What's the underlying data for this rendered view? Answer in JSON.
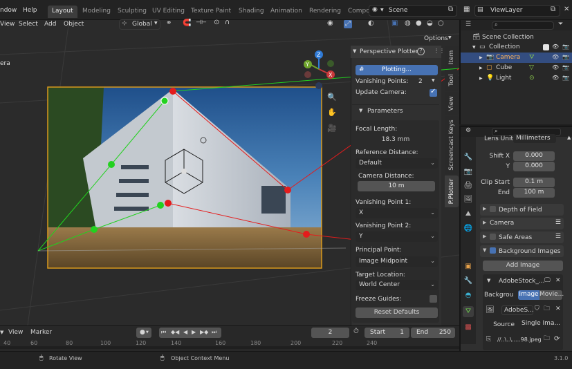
{
  "topbar": {
    "menus": [
      "ndow",
      "Help"
    ],
    "workspaces": [
      "Layout",
      "Modeling",
      "Sculpting",
      "UV Editing",
      "Texture Paint",
      "Shading",
      "Animation",
      "Rendering",
      "Compo"
    ],
    "active_workspace": "Layout",
    "scene_name": "Scene",
    "view_layer_name": "ViewLayer"
  },
  "viewport_header": {
    "menus": [
      "View",
      "Select",
      "Add",
      "Object"
    ],
    "orientation": "Global",
    "options_label": "Options"
  },
  "viewport": {
    "corner_text_1": "",
    "corner_text_2": "era"
  },
  "npanel": {
    "title": "Perspective Plotter",
    "plotting_button": "Plotting...",
    "vanishing_points_label": "Vanishing Points:",
    "vanishing_points_value": "2",
    "update_camera_label": "Update Camera:",
    "update_camera_checked": true,
    "parameters_label": "Parameters",
    "focal_length_label": "Focal Length:",
    "focal_length_value": "18.3 mm",
    "reference_distance_label": "Reference Distance:",
    "reference_distance_value": "Default",
    "camera_distance_label": "Camera Distance:",
    "camera_distance_value": "10 m",
    "vp1_label": "Vanishing Point 1:",
    "vp1_value": "X",
    "vp2_label": "Vanishing Point 2:",
    "vp2_value": "Y",
    "principal_point_label": "Principal Point:",
    "principal_point_value": "Image Midpoint",
    "target_location_label": "Target Location:",
    "target_location_value": "World Center",
    "freeze_guides_label": "Freeze Guides:",
    "freeze_guides_checked": false,
    "reset_button": "Reset Defaults"
  },
  "npanel_tabs": [
    "Item",
    "Tool",
    "View",
    "Screencast Keys",
    "P.Plotter"
  ],
  "active_npanel_tab": "P.Plotter",
  "outliner": {
    "items": [
      {
        "label": "Scene Collection",
        "indent": 0
      },
      {
        "label": "Collection",
        "indent": 1
      },
      {
        "label": "Camera",
        "indent": 2,
        "selected": true
      },
      {
        "label": "Cube",
        "indent": 2
      },
      {
        "label": "Light",
        "indent": 2
      }
    ]
  },
  "properties": {
    "lens_unit_label": "Lens Unit",
    "lens_unit_value": "Millimeters",
    "shift_x_label": "Shift X",
    "shift_x_value": "0.000",
    "shift_y_label": "Y",
    "shift_y_value": "0.000",
    "clip_start_label": "Clip Start",
    "clip_start_value": "0.1 m",
    "clip_end_label": "End",
    "clip_end_value": "100 m",
    "panels": [
      "Depth of Field",
      "Camera",
      "Safe Areas",
      "Background Images"
    ],
    "add_image_button": "Add Image",
    "bg_item_name": "AdobeStock_...",
    "background_label": "Backgrou",
    "image_tab": "Image",
    "movie_tab": "Movie...",
    "image_name": "AdobeS...",
    "source_label": "Source",
    "source_value": "Single Ima...",
    "path_value": "//..\\..\\.....98.jpeg"
  },
  "timeline": {
    "menus": [
      "View",
      "Marker"
    ],
    "current_frame": "2",
    "start_label": "Start",
    "start_value": "1",
    "end_label": "End",
    "end_value": "250",
    "ticks": [
      "40",
      "60",
      "80",
      "100",
      "120",
      "140",
      "160",
      "180",
      "200",
      "220",
      "240"
    ]
  },
  "statusbar": {
    "hint_1": "Rotate View",
    "hint_2": "Object Context Menu",
    "version": "3.1.0"
  },
  "colors": {
    "accent": "#4772b3",
    "vp_red": "#e41c1c",
    "vp_green": "#22d11f",
    "frame_orange": "#d99a1c"
  }
}
